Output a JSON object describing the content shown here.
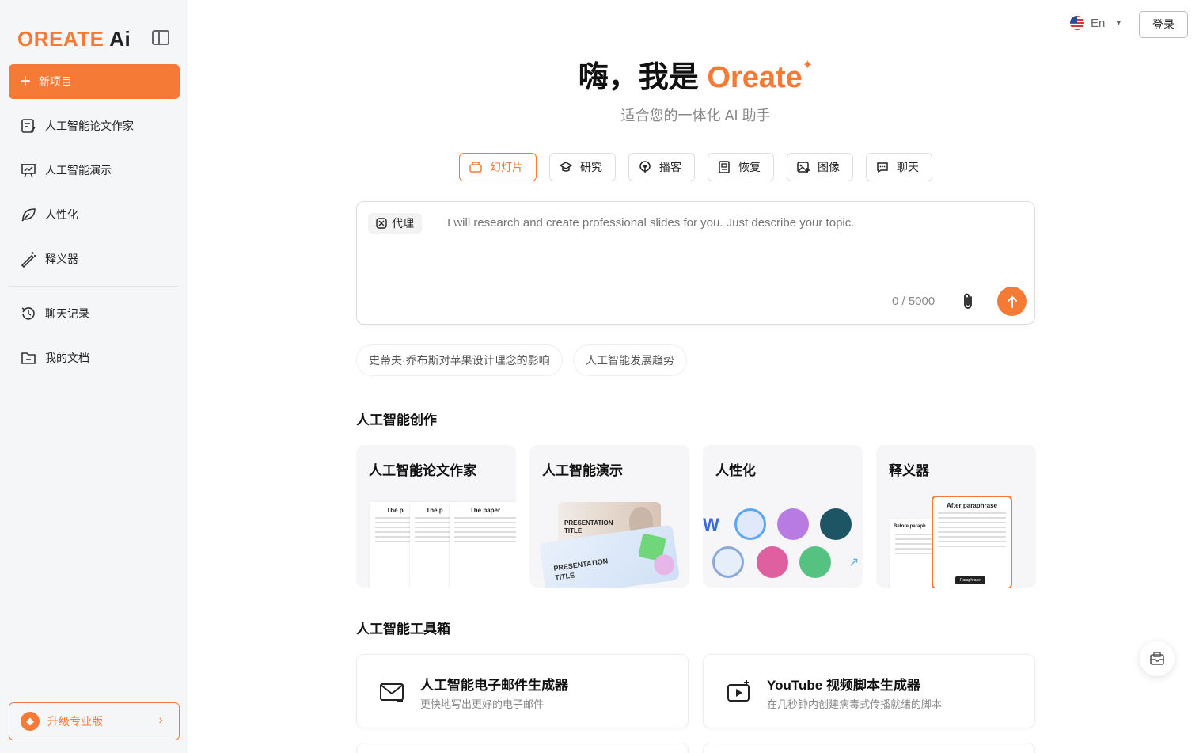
{
  "sidebar": {
    "logo_main": "OREATE",
    "logo_ai": "Ai",
    "new_project": "新项目",
    "items": [
      {
        "label": "人工智能论文作家",
        "icon": "document-edit-icon"
      },
      {
        "label": "人工智能演示",
        "icon": "presentation-icon"
      },
      {
        "label": "人性化",
        "icon": "leaf-icon"
      },
      {
        "label": "释义器",
        "icon": "magic-wand-icon"
      },
      {
        "label": "聊天记录",
        "icon": "history-icon"
      },
      {
        "label": "我的文档",
        "icon": "folder-icon"
      }
    ],
    "upgrade": "升级专业版"
  },
  "header": {
    "language": "En",
    "login": "登录"
  },
  "hero": {
    "title_prefix": "嗨，我是",
    "brand": "Oreate",
    "subtitle": "适合您的一体化 AI 助手"
  },
  "modes": [
    {
      "label": "幻灯片",
      "icon": "slides-icon",
      "active": true
    },
    {
      "label": "研究",
      "icon": "graduation-cap-icon",
      "active": false
    },
    {
      "label": "播客",
      "icon": "podcast-icon",
      "active": false
    },
    {
      "label": "恢复",
      "icon": "resume-icon",
      "active": false
    },
    {
      "label": "图像",
      "icon": "image-icon",
      "active": false
    },
    {
      "label": "聊天",
      "icon": "chat-icon",
      "active": false
    }
  ],
  "input": {
    "agent_label": "代理",
    "placeholder": "I will research and create professional slides for you. Just describe your topic.",
    "counter": "0 / 5000"
  },
  "suggestions": [
    "史蒂夫·乔布斯对苹果设计理念的影响",
    "人工智能发展趋势"
  ],
  "creation": {
    "title": "人工智能创作",
    "cards": [
      {
        "title": "人工智能论文作家",
        "thumb_text": [
          "The p",
          "The p",
          "The paper"
        ]
      },
      {
        "title": "人工智能演示",
        "thumb_text": [
          "PRESENTATION TITLE",
          "PRESENTATION TITLE"
        ]
      },
      {
        "title": "人性化"
      },
      {
        "title": "释义器",
        "thumb_text": [
          "After paraphrase",
          "Before paraph",
          "Paraphrase"
        ]
      }
    ]
  },
  "toolbox": {
    "title": "人工智能工具箱",
    "tools": [
      {
        "title": "人工智能电子邮件生成器",
        "desc": "更快地写出更好的电子邮件",
        "icon": "email-icon"
      },
      {
        "title": "YouTube 视频脚本生成器",
        "desc": "在几秒钟内创建病毒式传播就绪的脚本",
        "icon": "video-icon"
      }
    ]
  },
  "colors": {
    "accent": "#f47a35",
    "text": "#222222",
    "muted": "#888888"
  }
}
